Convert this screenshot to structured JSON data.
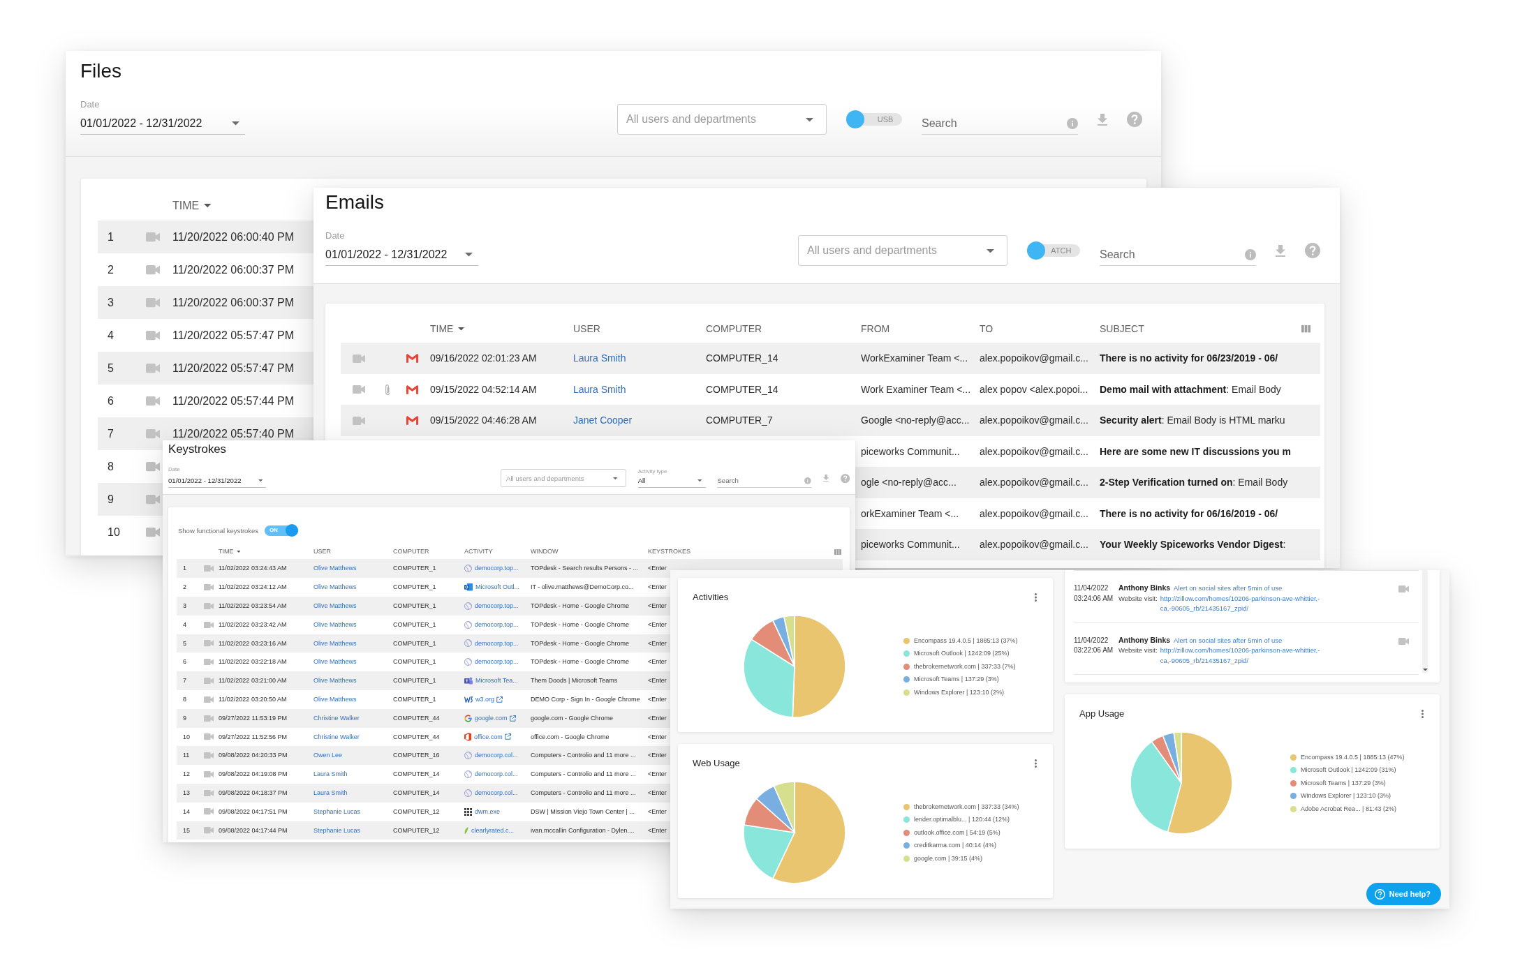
{
  "files_window": {
    "title": "Files",
    "date": {
      "label": "Date",
      "value": "01/01/2022 - 12/31/2022"
    },
    "user_filter": "All users and departments",
    "toggle": {
      "label": "USB",
      "on": false
    },
    "search": {
      "placeholder": "Search"
    },
    "table": {
      "columns": [
        {
          "label": "TIME",
          "sorted": true
        }
      ],
      "rows": [
        {
          "number": "1",
          "time": "11/20/2022 06:00:40 PM"
        },
        {
          "number": "2",
          "time": "11/20/2022 06:00:37 PM"
        },
        {
          "number": "3",
          "time": "11/20/2022 06:00:37 PM"
        },
        {
          "number": "4",
          "time": "11/20/2022 05:57:47 PM"
        },
        {
          "number": "5",
          "time": "11/20/2022 05:57:47 PM"
        },
        {
          "number": "6",
          "time": "11/20/2022 05:57:44 PM"
        },
        {
          "number": "7",
          "time": "11/20/2022 05:57:40 PM"
        },
        {
          "number": "8"
        },
        {
          "number": "9"
        },
        {
          "number": "10"
        }
      ]
    }
  },
  "emails_window": {
    "title": "Emails",
    "date": {
      "label": "Date",
      "value": "01/01/2022 - 12/31/2022"
    },
    "user_filter": "All users and departments",
    "toggle": {
      "label": "ATCH",
      "on": false
    },
    "search": {
      "placeholder": "Search"
    },
    "table": {
      "columns": [
        {
          "label": "TIME",
          "sorted": true
        },
        {
          "label": "USER",
          "sorted": false
        },
        {
          "label": "COMPUTER",
          "sorted": false
        },
        {
          "label": "FROM",
          "sorted": false
        },
        {
          "label": "TO",
          "sorted": false
        },
        {
          "label": "SUBJECT",
          "sorted": false
        }
      ],
      "rows": [
        {
          "attachment": false,
          "time": "09/16/2022 02:01:23 AM",
          "user": "Laura Smith",
          "computer": "COMPUTER_14",
          "from": "WorkExaminer Team <...",
          "to": "alex.popoikov@gmail.c...",
          "subject": "There is no activity for 06/23/2019 - 06/"
        },
        {
          "attachment": true,
          "time": "09/15/2022 04:52:14 AM",
          "user": "Laura Smith",
          "computer": "COMPUTER_14",
          "from": "Work Examiner Team <...",
          "to": "alex popov <alex.popoi...",
          "subject": "Demo mail with attachment",
          "preview": ": Email Body"
        },
        {
          "attachment": false,
          "time": "09/15/2022 04:46:28 AM",
          "user": "Janet Cooper",
          "computer": "COMPUTER_7",
          "from": "Google <no-reply@acc...",
          "to": "alex.popoikov@gmail.c...",
          "subject": "Security alert",
          "preview": ": Email Body is HTML marku"
        },
        {
          "from": "piceworks Communit...",
          "to": "alex.popoikov@gmail.c...",
          "subject": "Here are some new IT discussions you m"
        },
        {
          "from": "ogle <no-reply@acc...",
          "to": "alex.popoikov@gmail.c...",
          "subject": "2-Step Verification turned on",
          "preview": ": Email Body"
        },
        {
          "from": "orkExaminer Team <...",
          "to": "alex.popoikov@gmail.c...",
          "subject": "There is no activity for 06/16/2019 - 06/"
        },
        {
          "from": "piceworks Communit...",
          "to": "alex.popoikov@gmail.c...",
          "subject": "Your Weekly Spiceworks Vendor Digest",
          "preview": ":"
        }
      ]
    }
  },
  "keystrokes_window": {
    "title": "Keystrokes",
    "date": {
      "label": "Date",
      "value": "01/01/2022 - 12/31/2022"
    },
    "user_filter": "All users and departments",
    "activity_type": {
      "label": "Activity type",
      "value": "All"
    },
    "search": {
      "placeholder": "Search"
    },
    "functional_toggle": {
      "label": "Show functional keystrokes",
      "state_text": "ON",
      "on": true
    },
    "table": {
      "columns": [
        {
          "label": "TIME",
          "sorted": true
        },
        {
          "label": "USER",
          "sorted": false
        },
        {
          "label": "COMPUTER",
          "sorted": false
        },
        {
          "label": "ACTIVITY",
          "sorted": false
        },
        {
          "label": "WINDOW",
          "sorted": false
        },
        {
          "label": "KEYSTROKES",
          "sorted": false
        }
      ],
      "rows": [
        {
          "number": "1",
          "time": "11/02/2022 03:24:43 AM",
          "user": "Olive Matthews",
          "computer": "COMPUTER_1",
          "activity": {
            "kind": "web",
            "name": "democorp.top...",
            "external": false
          },
          "window": "TOPdesk - Search results Persons - ...",
          "keystrokes": "<Enter"
        },
        {
          "number": "2",
          "time": "11/02/2022 03:24:12 AM",
          "user": "Olive Matthews",
          "computer": "COMPUTER_1",
          "activity": {
            "kind": "outlook",
            "name": "Microsoft Outl...",
            "external": false
          },
          "window": "IT - olive.matthews@DemoCorp.co...",
          "keystrokes": "<Enter"
        },
        {
          "number": "3",
          "time": "11/02/2022 03:23:54 AM",
          "user": "Olive Matthews",
          "computer": "COMPUTER_1",
          "activity": {
            "kind": "web",
            "name": "democorp.top...",
            "external": false
          },
          "window": "TOPdesk - Home - Google Chrome",
          "keystrokes": "<Enter"
        },
        {
          "number": "4",
          "time": "11/02/2022 03:23:42 AM",
          "user": "Olive Matthews",
          "computer": "COMPUTER_1",
          "activity": {
            "kind": "web",
            "name": "democorp.top...",
            "external": false
          },
          "window": "TOPdesk - Home - Google Chrome",
          "keystrokes": "<Enter"
        },
        {
          "number": "5",
          "time": "11/02/2022 03:23:16 AM",
          "user": "Olive Matthews",
          "computer": "COMPUTER_1",
          "activity": {
            "kind": "web",
            "name": "democorp.top...",
            "external": false
          },
          "window": "TOPdesk - Home - Google Chrome",
          "keystrokes": "<Enter"
        },
        {
          "number": "6",
          "time": "11/02/2022 03:22:18 AM",
          "user": "Olive Matthews",
          "computer": "COMPUTER_1",
          "activity": {
            "kind": "web",
            "name": "democorp.top...",
            "external": false
          },
          "window": "TOPdesk - Home - Google Chrome",
          "keystrokes": "<Enter"
        },
        {
          "number": "7",
          "time": "11/02/2022 03:21:00 AM",
          "user": "Olive Matthews",
          "computer": "COMPUTER_1",
          "activity": {
            "kind": "teams",
            "name": "Microsoft Tea...",
            "external": false
          },
          "window": "Them Doods | Microsoft Teams",
          "keystrokes": "<Enter"
        },
        {
          "number": "8",
          "time": "11/02/2022 03:20:50 AM",
          "user": "Olive Matthews",
          "computer": "COMPUTER_1",
          "activity": {
            "kind": "w3",
            "name": "w3.org",
            "external": true
          },
          "window": "DEMO Corp - Sign In - Google Chrome",
          "keystrokes": "<Enter"
        },
        {
          "number": "9",
          "time": "09/27/2022 11:53:19 PM",
          "user": "Christine Walker",
          "computer": "COMPUTER_44",
          "activity": {
            "kind": "google",
            "name": "google.com",
            "external": true
          },
          "window": "google.com - Google Chrome",
          "keystrokes": "<Enter"
        },
        {
          "number": "10",
          "time": "09/27/2022 11:52:56 PM",
          "user": "Christine Walker",
          "computer": "COMPUTER_44",
          "activity": {
            "kind": "office",
            "name": "office.com",
            "external": true
          },
          "window": "office.com - Google Chrome",
          "keystrokes": "<Enter"
        },
        {
          "number": "11",
          "time": "09/08/2022 04:20:33 PM",
          "user": "Owen Lee",
          "computer": "COMPUTER_16",
          "activity": {
            "kind": "web",
            "name": "democorp.col...",
            "external": false
          },
          "window": "Computers - Controlio and 11 more ...",
          "keystrokes": "<Enter"
        },
        {
          "number": "12",
          "time": "09/08/2022 04:19:08 PM",
          "user": "Laura Smith",
          "computer": "COMPUTER_14",
          "activity": {
            "kind": "web",
            "name": "democorp.col...",
            "external": false
          },
          "window": "Computers - Controlio and 11 more ...",
          "keystrokes": "<Enter"
        },
        {
          "number": "13",
          "time": "09/08/2022 04:18:37 PM",
          "user": "Laura Smith",
          "computer": "COMPUTER_14",
          "activity": {
            "kind": "web",
            "name": "democorp.col...",
            "external": false
          },
          "window": "Computers - Controlio and 11 more ...",
          "keystrokes": "<Enter"
        },
        {
          "number": "14",
          "time": "09/08/2022 04:17:51 PM",
          "user": "Stephanie Lucas",
          "computer": "COMPUTER_12",
          "activity": {
            "kind": "exe",
            "name": "dwm.exe",
            "external": false
          },
          "window": "DSW | Mission Viejo Town Center | ...",
          "keystrokes": "<Enter"
        },
        {
          "number": "15",
          "time": "09/08/2022 04:17:44 PM",
          "user": "Stephanie Lucas",
          "computer": "COMPUTER_12",
          "activity": {
            "kind": "leaf",
            "name": "clearlyrated.c...",
            "external": false
          },
          "window": "ivan.mccallin Configuration - Dylen....",
          "keystrokes": "<Enter"
        }
      ]
    }
  },
  "dashboard": {
    "activities": {
      "title": "Activities",
      "legend": [
        {
          "label": "Encompass 19.4.0.5 | 1885:13 (37%)",
          "color": "#e8c56e"
        },
        {
          "label": "Microsoft Outlook | 1242:09 (25%)",
          "color": "#88e6da"
        },
        {
          "label": "thebrokernetwork.com | 337:33 (7%)",
          "color": "#e38c77"
        },
        {
          "label": "Microsoft Teams | 137:29 (3%)",
          "color": "#79aee0"
        },
        {
          "label": "Windows Explorer | 123:10 (2%)",
          "color": "#d6df8e"
        }
      ],
      "chart_data": {
        "type": "pie",
        "values": [
          50.6,
          33.34,
          9.06,
          3.69,
          3.31
        ]
      }
    },
    "web_usage": {
      "title": "Web Usage",
      "legend": [
        {
          "label": "thebrokernetwork.com | 337:33 (34%)",
          "color": "#e8c56e"
        },
        {
          "label": "lender.optimalblu... | 120:44 (12%)",
          "color": "#88e6da"
        },
        {
          "label": "outlook.office.com | 54:19 (5%)",
          "color": "#e38c77"
        },
        {
          "label": "creditkarma.com | 40:14 (4%)",
          "color": "#79aee0"
        },
        {
          "label": "google.com | 39:15 (4%)",
          "color": "#d6df8e"
        }
      ],
      "chart_data": {
        "type": "pie",
        "values": [
          57.02,
          20.39,
          9.17,
          6.79,
          6.63
        ]
      }
    },
    "alerts": [
      {
        "date": "11/04/2022",
        "time": "03:24:06 AM",
        "user": "Anthony Binks",
        "rule": "Alert on social sites after 5min of use",
        "detail_label": "Website visit:",
        "url": "http://zillow.com/homes/10206-parkinson-ave-whittier,-ca,-90605_rb/21435167_zpid/"
      },
      {
        "date": "11/04/2022",
        "time": "03:22:06 AM",
        "user": "Anthony Binks",
        "rule": "Alert on social sites after 5min of use",
        "detail_label": "Website visit:",
        "url": "http://zillow.com/homes/10206-parkinson-ave-whittier,-ca,-90605_rb/21435167_zpid/"
      }
    ],
    "app_usage": {
      "title": "App Usage",
      "legend": [
        {
          "label": "Encompass 19.4.0.5 | 1885:13 (47%)",
          "color": "#e8c56e"
        },
        {
          "label": "Microsoft Outlook | 1242:09 (31%)",
          "color": "#88e6da"
        },
        {
          "label": "Microsoft Teams | 137:29 (3%)",
          "color": "#e38c77"
        },
        {
          "label": "Windows Explorer | 123:10 (3%)",
          "color": "#79aee0"
        },
        {
          "label": "Adobe Acrobat Rea... | 81:43 (2%)",
          "color": "#d6df8e"
        }
      ],
      "chart_data": {
        "type": "pie",
        "values": [
          54.33,
          35.8,
          3.96,
          3.55,
          2.36
        ]
      }
    },
    "help_button": {
      "label": "Need help?"
    }
  }
}
